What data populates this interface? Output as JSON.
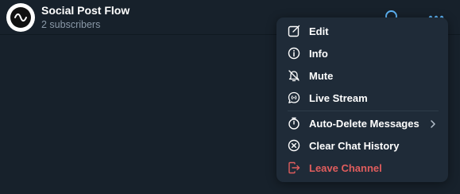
{
  "header": {
    "title": "Social Post Flow",
    "subtitle": "2 subscribers",
    "icons": [
      "search-icon",
      "more-icon"
    ]
  },
  "menu": {
    "items": [
      {
        "label": "Edit",
        "icon": "edit-icon"
      },
      {
        "label": "Info",
        "icon": "info-icon"
      },
      {
        "label": "Mute",
        "icon": "mute-icon"
      },
      {
        "label": "Live Stream",
        "icon": "live-stream-icon"
      },
      {
        "label": "Auto-Delete Messages",
        "icon": "timer-icon",
        "has_submenu": true
      },
      {
        "label": "Clear Chat History",
        "icon": "clear-icon"
      },
      {
        "label": "Leave Channel",
        "icon": "leave-icon",
        "danger": true
      }
    ]
  },
  "colors": {
    "background": "#17212b",
    "menu_background": "#1f2b38",
    "accent": "#5eb5f7",
    "danger": "#e05d5d",
    "subtitle": "#8a99a8"
  }
}
